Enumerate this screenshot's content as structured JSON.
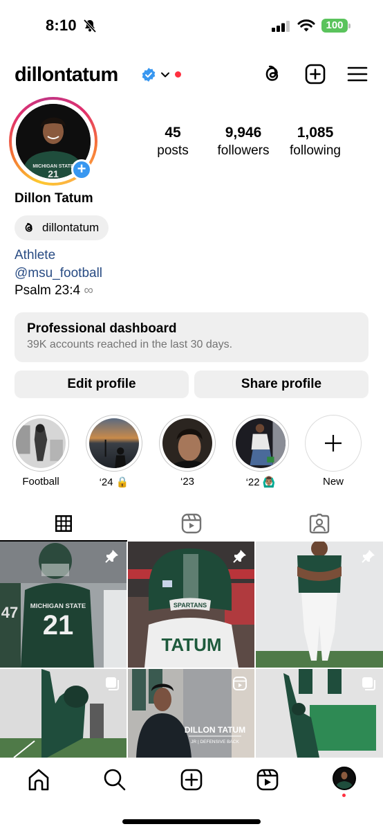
{
  "status_bar": {
    "time": "8:10",
    "silent_icon": "bell-slash-icon",
    "signal_icon": "cellular-signal-icon",
    "wifi_icon": "wifi-icon",
    "battery": "100",
    "battery_color": "#5ac35c"
  },
  "header": {
    "username": "dillontatum",
    "verified_icon": "verified-badge-icon",
    "verified_color": "#3897f0",
    "switcher_icon": "chevron-down-icon",
    "notification_dot_color": "#ff3040",
    "actions": [
      {
        "name": "threads-icon"
      },
      {
        "name": "create-plus-square-icon"
      },
      {
        "name": "menu-hamburger-icon"
      }
    ]
  },
  "profile": {
    "full_name": "Dillon Tatum",
    "add_story_label": "+",
    "stats": [
      {
        "value": "45",
        "label": "posts"
      },
      {
        "value": "9,946",
        "label": "followers"
      },
      {
        "value": "1,085",
        "label": "following"
      }
    ],
    "threads_handle": "dillontatum",
    "bio": {
      "category": "Athlete",
      "mention": "@msu_football",
      "text": "Psalm 23:4",
      "emoji": "∞"
    },
    "link_color": "#284b83"
  },
  "dashboard": {
    "title": "Professional dashboard",
    "subtitle": "39K accounts reached in the last 30 days."
  },
  "buttons": {
    "edit": "Edit profile",
    "share": "Share profile"
  },
  "highlights": [
    {
      "label": "Football"
    },
    {
      "label": "‘24 🔒"
    },
    {
      "label": "‘23"
    },
    {
      "label": "‘22 🙆🏽‍♂️"
    },
    {
      "label": "New"
    }
  ],
  "tabs": [
    {
      "name": "grid-icon",
      "active": true
    },
    {
      "name": "reels-icon",
      "active": false
    },
    {
      "name": "tagged-icon",
      "active": false
    }
  ],
  "posts": [
    {
      "description": "Player #21 Michigan State jersey on field",
      "badge": "pin-icon",
      "jersey_text": "MICHIGAN STATE",
      "number": "21"
    },
    {
      "description": "Back of helmet with TATUM nameplate",
      "badge": "pin-icon",
      "helmet_text": "SPARTANS",
      "name_text": "TATUM"
    },
    {
      "description": "Studio portrait in green jersey and white pants",
      "badge": "pin-icon"
    },
    {
      "description": "Player reaching to catch ball indoor",
      "badge": "carousel-icon"
    },
    {
      "description": "Video intro clip",
      "badge": "reel-icon",
      "overlay_title": "DILLON TATUM",
      "overlay_sub": "JR | DEFENSIVE BACK"
    },
    {
      "description": "Player leaping indoor practice",
      "badge": "carousel-icon"
    }
  ],
  "bottom_nav": [
    {
      "name": "home-icon"
    },
    {
      "name": "search-icon"
    },
    {
      "name": "create-icon"
    },
    {
      "name": "reels-icon"
    },
    {
      "name": "profile-avatar"
    }
  ]
}
